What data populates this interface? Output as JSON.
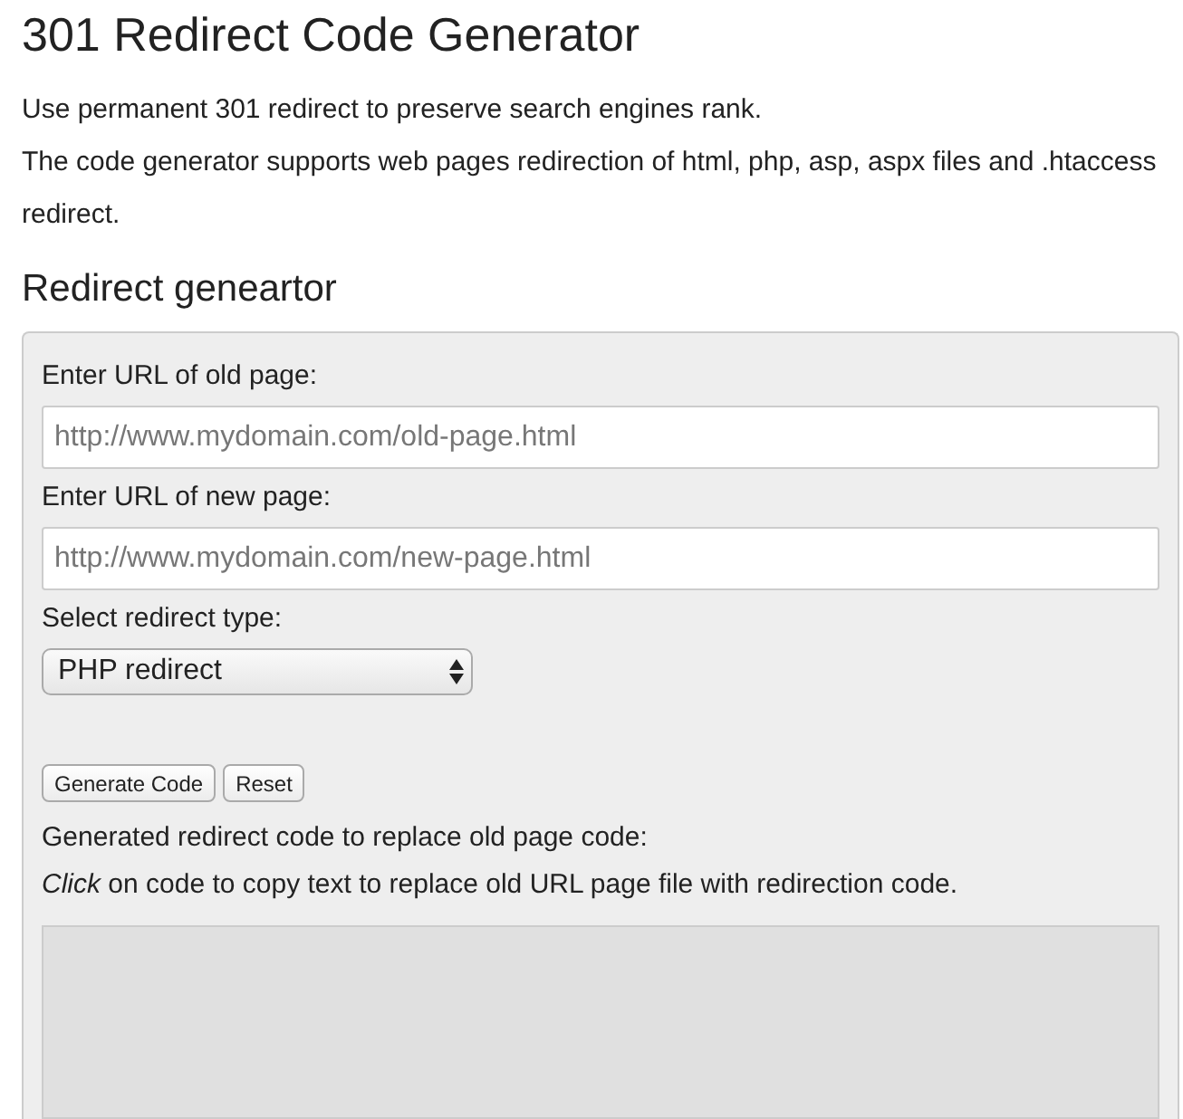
{
  "title": "301 Redirect Code Generator",
  "intro": [
    "Use permanent 301 redirect to preserve search engines rank.",
    "The code generator supports web pages redirection of html, php, asp, aspx files and .htaccess redirect."
  ],
  "section_title": "Redirect geneartor",
  "fields": [
    {
      "label": "Enter URL of old page:",
      "placeholder": "http://www.mydomain.com/old-page.html"
    },
    {
      "label": "Enter URL of new page:",
      "placeholder": "http://www.mydomain.com/new-page.html"
    }
  ],
  "select": {
    "label": "Select redirect type:",
    "value": "PHP redirect"
  },
  "buttons": [
    "Generate Code",
    "Reset"
  ],
  "output_label": "Generated redirect code to replace old page code:",
  "hint": "*Click* on code to copy text to replace old URL page file with redirection code."
}
